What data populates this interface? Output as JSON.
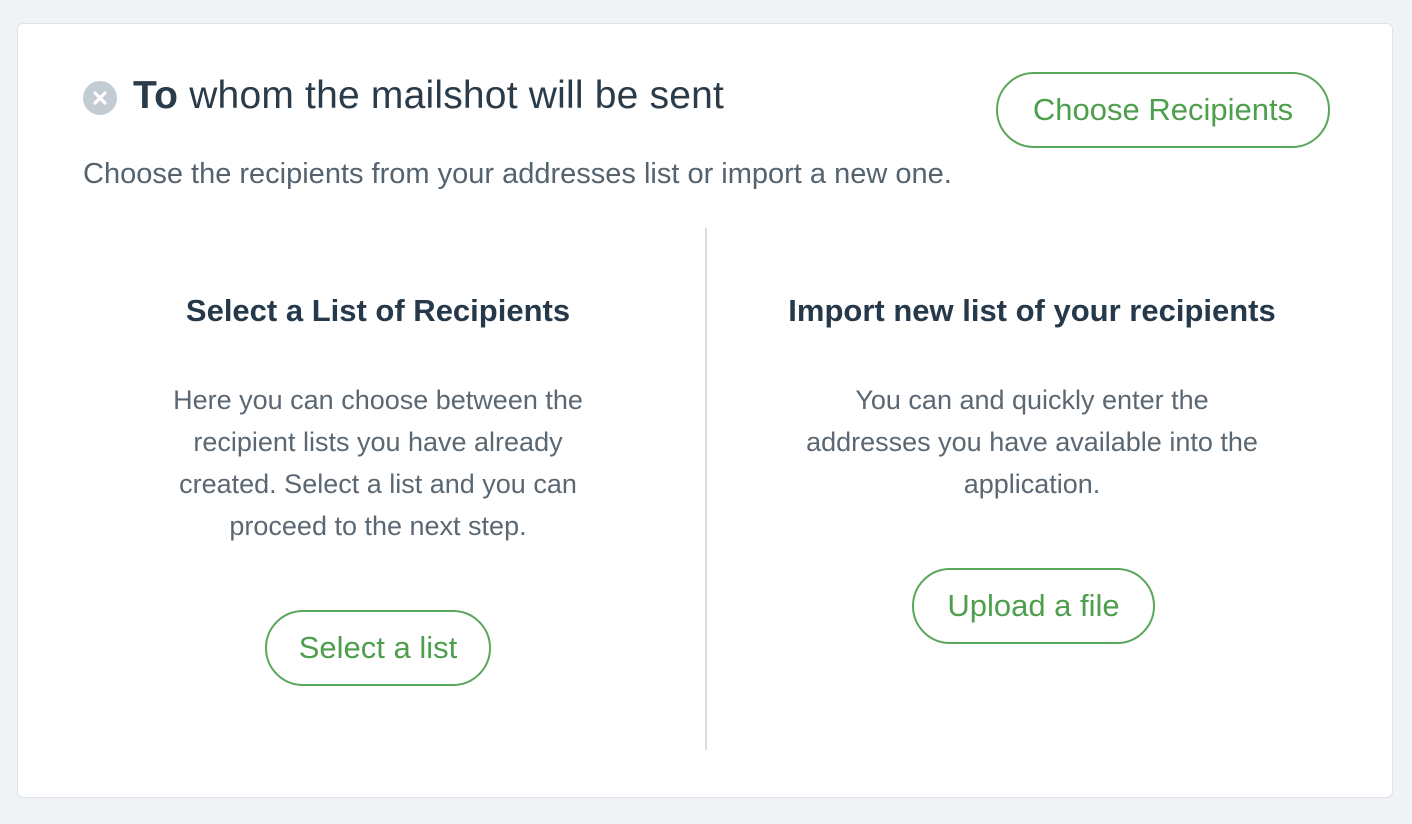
{
  "section": {
    "title_bold": "To",
    "title_rest": " whom the mailshot will be sent",
    "subtitle": "Choose the recipients from your addresses list or import a new one.",
    "status_icon": "close-circle-icon",
    "choose_button": "Choose Recipients"
  },
  "left_panel": {
    "title": "Select a List of Recipients",
    "description": "Here you can choose between the recipient lists you have already created. Select a list and you can proceed to the next step.",
    "button": "Select a list"
  },
  "right_panel": {
    "title": "Import new list of your recipients",
    "description": "You can and quickly enter the addresses you have available into the application.",
    "button": "Upload a file"
  },
  "colors": {
    "accent_green": "#4d9e4d",
    "heading": "#2a3b49",
    "body_text": "#5b6873",
    "icon_gray": "#c3cbd3",
    "background": "#eff3f6"
  }
}
